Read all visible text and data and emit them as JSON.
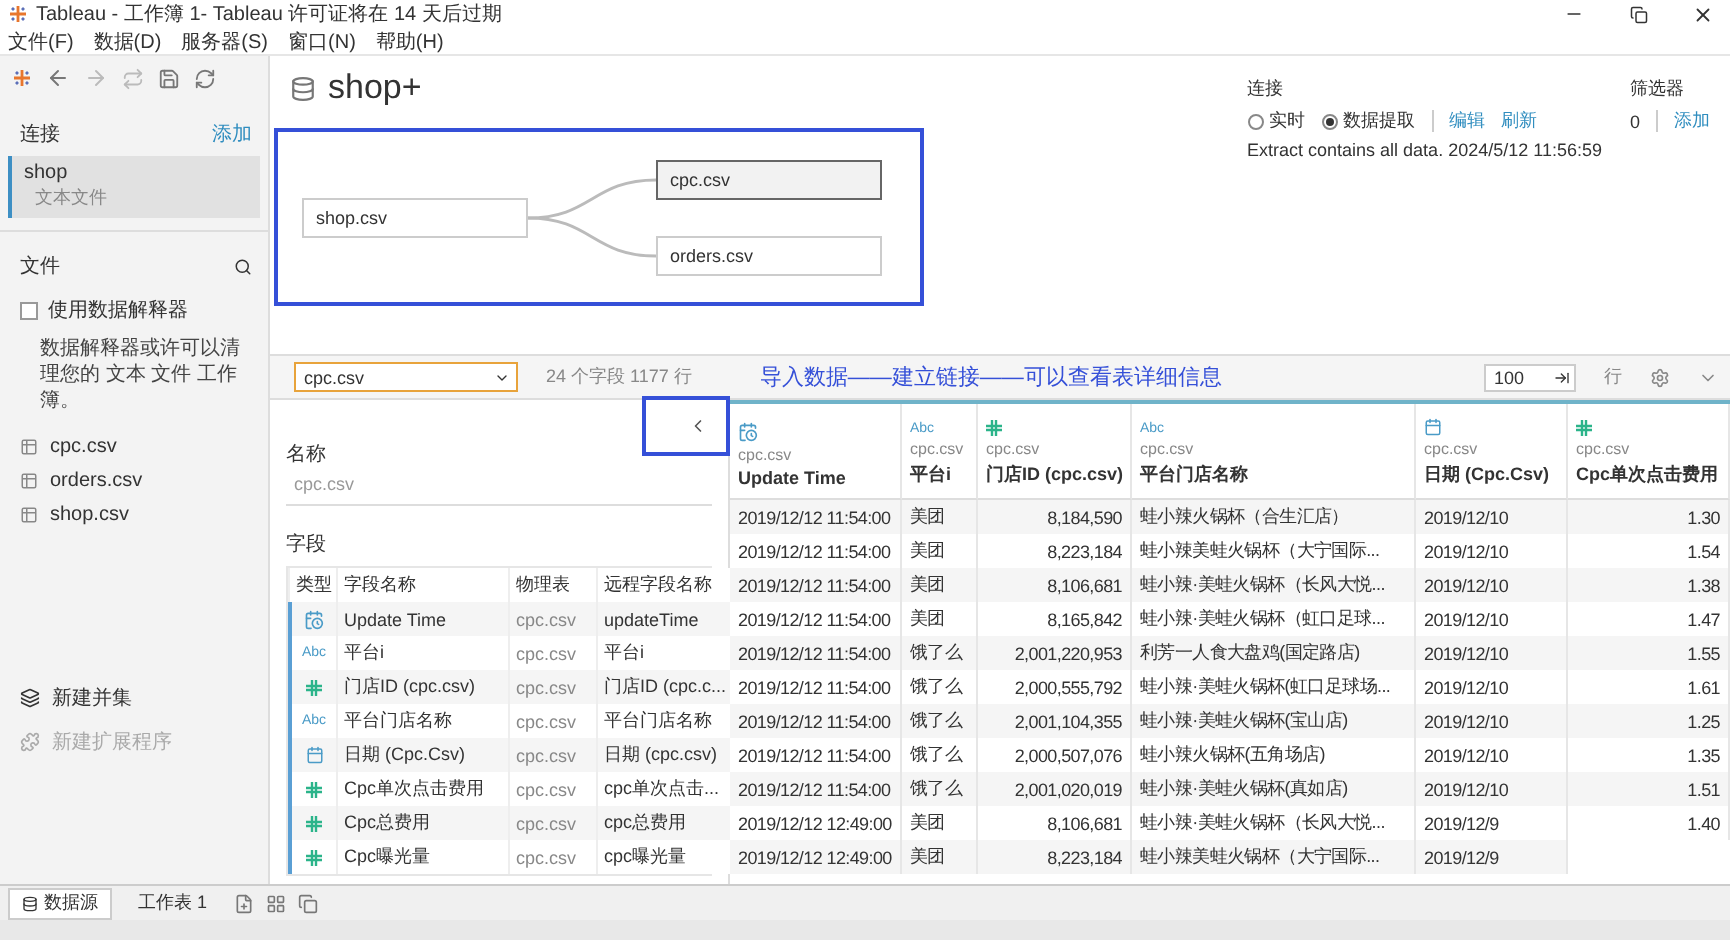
{
  "window": {
    "title": "Tableau - 工作簿 1- Tableau 许可证将在 14 天后过期"
  },
  "menu": [
    "文件(F)",
    "数据(D)",
    "服务器(S)",
    "窗口(N)",
    "帮助(H)"
  ],
  "sidebar": {
    "connections_label": "连接",
    "add_link": "添加",
    "connections": [
      {
        "name": "shop",
        "type": "文本文件",
        "selected": true
      }
    ],
    "files_label": "文件",
    "interpreter": {
      "label": "使用数据解释器",
      "checked": false
    },
    "interpreter_note": "数据解释器或许可以清理您的 文本 文件 工作簿。",
    "files": [
      "cpc.csv",
      "orders.csv",
      "shop.csv"
    ],
    "actions": [
      {
        "kind": "union",
        "label": "新建并集",
        "disabled": false
      },
      {
        "kind": "extension",
        "label": "新建扩展程序",
        "disabled": true
      }
    ]
  },
  "datasource": {
    "title": "shop+",
    "connection": {
      "label": "连接",
      "modes": [
        {
          "label": "实时",
          "selected": false
        },
        {
          "label": "数据提取",
          "selected": true
        }
      ],
      "links": [
        "编辑",
        "刷新"
      ],
      "status": "Extract contains all data. 2024/5/12 11:56:59"
    },
    "filters": {
      "label": "筛选器",
      "count": "0",
      "add": "添加"
    }
  },
  "canvas": {
    "root": {
      "label": "shop.csv",
      "selected": false
    },
    "joined": [
      {
        "label": "cpc.csv",
        "selected": true
      },
      {
        "label": "orders.csv",
        "selected": false
      }
    ]
  },
  "table_bar": {
    "table": "cpc.csv",
    "summary": "24 个字段 1177 行",
    "annotation": "导入数据——建立链接——可以查看表详细信息",
    "row_limit": "100",
    "rows_label": "行"
  },
  "metadata": {
    "name_label": "名称",
    "name": "cpc.csv",
    "fields_label": "字段",
    "columns": [
      "类型",
      "字段名称",
      "物理表",
      "远程字段名称"
    ],
    "rows": [
      {
        "kind": "datetime",
        "name": "Update Time",
        "table": "cpc.csv",
        "remote": "updateTime"
      },
      {
        "kind": "string",
        "type_label": "Abc",
        "name": "平台i",
        "table": "cpc.csv",
        "remote": "平台i"
      },
      {
        "kind": "number",
        "name": "门店ID (cpc.csv)",
        "table": "cpc.csv",
        "remote": "门店ID (cpc.c..."
      },
      {
        "kind": "string",
        "type_label": "Abc",
        "name": "平台门店名称",
        "table": "cpc.csv",
        "remote": "平台门店名称"
      },
      {
        "kind": "date",
        "name": "日期 (Cpc.Csv)",
        "table": "cpc.csv",
        "remote": "日期 (cpc.csv)"
      },
      {
        "kind": "number",
        "name": "Cpc单次点击费用",
        "table": "cpc.csv",
        "remote": "cpc单次点击..."
      },
      {
        "kind": "number",
        "name": "Cpc总费用",
        "table": "cpc.csv",
        "remote": "cpc总费用"
      },
      {
        "kind": "number",
        "name": "Cpc曝光量",
        "table": "cpc.csv",
        "remote": "cpc曝光量"
      }
    ]
  },
  "grid": {
    "columns": [
      {
        "kind": "datetime",
        "source": "cpc.csv",
        "name": "Update Time"
      },
      {
        "kind": "string",
        "type_label": "Abc",
        "source": "cpc.csv",
        "name": "平台i"
      },
      {
        "kind": "number",
        "source": "cpc.csv",
        "name": "门店ID (cpc.csv)"
      },
      {
        "kind": "string",
        "type_label": "Abc",
        "source": "cpc.csv",
        "name": "平台门店名称"
      },
      {
        "kind": "date",
        "source": "cpc.csv",
        "name": "日期 (Cpc.Csv)"
      },
      {
        "kind": "number",
        "source": "cpc.csv",
        "name": "Cpc单次点击费用"
      }
    ],
    "rows": [
      [
        "2019/12/12 11:54:00",
        "美团",
        "8,184,590",
        "蛙小辣火锅杯（合生汇店）",
        "2019/12/10",
        "1.30"
      ],
      [
        "2019/12/12 11:54:00",
        "美团",
        "8,223,184",
        "蛙小辣美蛙火锅杯（大宁国际...",
        "2019/12/10",
        "1.54"
      ],
      [
        "2019/12/12 11:54:00",
        "美团",
        "8,106,681",
        "蛙小辣·美蛙火锅杯（长风大悦...",
        "2019/12/10",
        "1.38"
      ],
      [
        "2019/12/12 11:54:00",
        "美团",
        "8,165,842",
        "蛙小辣·美蛙火锅杯（虹口足球...",
        "2019/12/10",
        "1.47"
      ],
      [
        "2019/12/12 11:54:00",
        "饿了么",
        "2,001,220,953",
        "利芳一人食大盘鸡(国定路店)",
        "2019/12/10",
        "1.55"
      ],
      [
        "2019/12/12 11:54:00",
        "饿了么",
        "2,000,555,792",
        "蛙小辣·美蛙火锅杯(虹口足球场...",
        "2019/12/10",
        "1.61"
      ],
      [
        "2019/12/12 11:54:00",
        "饿了么",
        "2,001,104,355",
        "蛙小辣·美蛙火锅杯(宝山店)",
        "2019/12/10",
        "1.25"
      ],
      [
        "2019/12/12 11:54:00",
        "饿了么",
        "2,000,507,076",
        "蛙小辣火锅杯(五角场店)",
        "2019/12/10",
        "1.35"
      ],
      [
        "2019/12/12 11:54:00",
        "饿了么",
        "2,001,020,019",
        "蛙小辣·美蛙火锅杯(真如店)",
        "2019/12/10",
        "1.51"
      ],
      [
        "2019/12/12 12:49:00",
        "美团",
        "8,106,681",
        "蛙小辣·美蛙火锅杯（长风大悦...",
        "2019/12/9",
        "1.40"
      ],
      [
        "2019/12/12 12:49:00",
        "美团",
        "8,223,184",
        "蛙小辣美蛙火锅杯（大宁国际...",
        "2019/12/9"
      ]
    ]
  },
  "sheet_tabs": [
    {
      "kind": "datasource",
      "label": "数据源",
      "selected": true
    },
    {
      "kind": "sheet",
      "label": "工作表 1",
      "selected": false
    }
  ]
}
